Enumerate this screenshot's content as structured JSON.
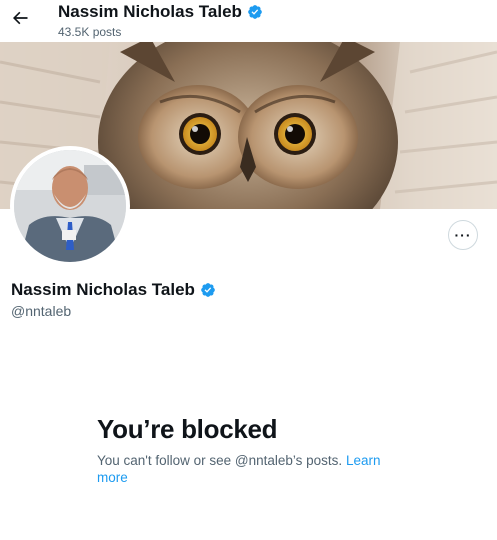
{
  "header": {
    "back_icon": "arrow-left-icon",
    "name": "Nassim Nicholas Taleb",
    "post_count": "43.5K posts"
  },
  "profile": {
    "name": "Nassim Nicholas Taleb",
    "handle": "@nntaleb",
    "verified_icon": "verified-badge-icon",
    "more_label": "···"
  },
  "blocked": {
    "title": "You’re blocked",
    "message": "You can't follow or see @nntaleb’s posts. ",
    "learn_more": "Learn more"
  },
  "colors": {
    "accent": "#1d9bf0",
    "text_primary": "#0f1419",
    "text_secondary": "#536471",
    "border": "#cfd9de"
  }
}
